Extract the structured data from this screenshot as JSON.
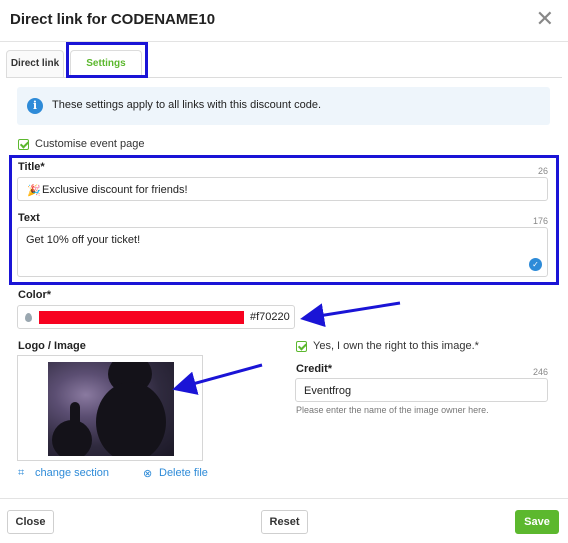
{
  "dialog": {
    "title": "Direct link for CODENAME10"
  },
  "tabs": [
    {
      "label": "Direct link",
      "active": false
    },
    {
      "label": "Settings",
      "active": true
    }
  ],
  "info": {
    "text": "These settings apply to all links with this discount code."
  },
  "customise": {
    "label": "Customise event page",
    "checked": true
  },
  "title_field": {
    "label": "Title*",
    "counter": "26",
    "emoji": "🎉",
    "value": "Exclusive discount for friends!"
  },
  "text_field": {
    "label": "Text",
    "counter": "176",
    "value": "Get 10% off your ticket!"
  },
  "color_field": {
    "label": "Color*",
    "value": "#f70220",
    "swatch": "#f70220"
  },
  "logo": {
    "label": "Logo / Image",
    "change_section": "change section",
    "delete_file": "Delete file"
  },
  "rights": {
    "label": "Yes, I own the right to this image.*",
    "checked": true
  },
  "credit_field": {
    "label": "Credit*",
    "counter": "246",
    "value": "Eventfrog",
    "hint": "Please enter the name of the image owner here."
  },
  "footer": {
    "close": "Close",
    "reset": "Reset",
    "save": "Save"
  },
  "colors": {
    "accent": "#5cb82e",
    "highlight": "#1a14d6",
    "info_bg": "#eef5fb",
    "link": "#2e8bd8"
  },
  "icons": [
    "close-icon",
    "info-icon",
    "checkbox-icon",
    "party-popper-icon",
    "spellcheck-icon",
    "color-drop-icon",
    "crop-icon",
    "delete-icon"
  ]
}
